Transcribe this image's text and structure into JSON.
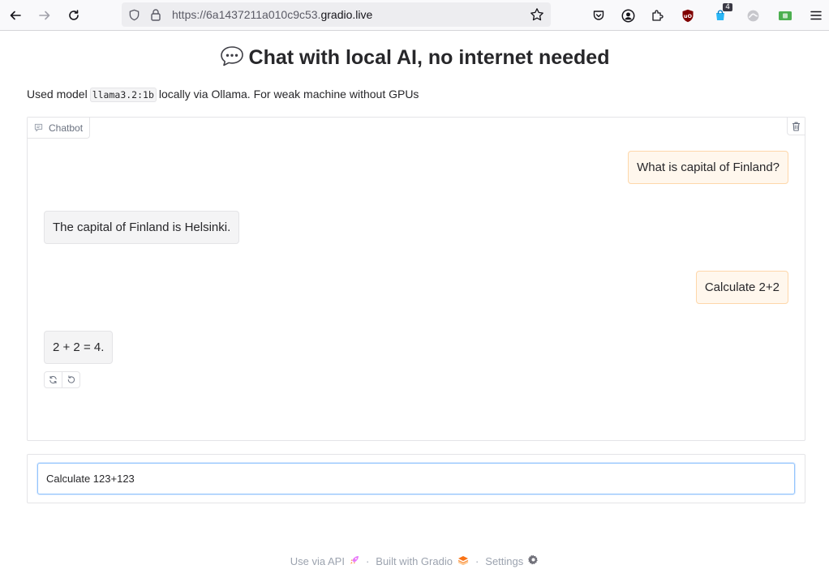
{
  "browser": {
    "url_prefix": "https://6a1437211a010c9c53.",
    "url_host": "gradio.live",
    "extension_badge": "4"
  },
  "page": {
    "title": "Chat with local AI, no internet needed",
    "desc_before": "Used model",
    "model_code": "llama3.2:1b",
    "desc_after": "locally via Ollama. For weak machine without GPUs"
  },
  "chatbot": {
    "label": "Chatbot",
    "messages": [
      {
        "role": "user",
        "text": "What is capital of Finland?"
      },
      {
        "role": "bot",
        "text": "The capital of Finland is Helsinki."
      },
      {
        "role": "user",
        "text": "Calculate 2+2"
      },
      {
        "role": "bot",
        "text": "2 + 2 = 4."
      }
    ]
  },
  "input": {
    "value": "Calculate 123+123"
  },
  "footer": {
    "api": "Use via API",
    "built": "Built with Gradio",
    "settings": "Settings",
    "separator": "·"
  },
  "colors": {
    "user_bubble": "#fff7ed",
    "bot_bubble": "#f4f4f5",
    "accent": "#f97316"
  }
}
